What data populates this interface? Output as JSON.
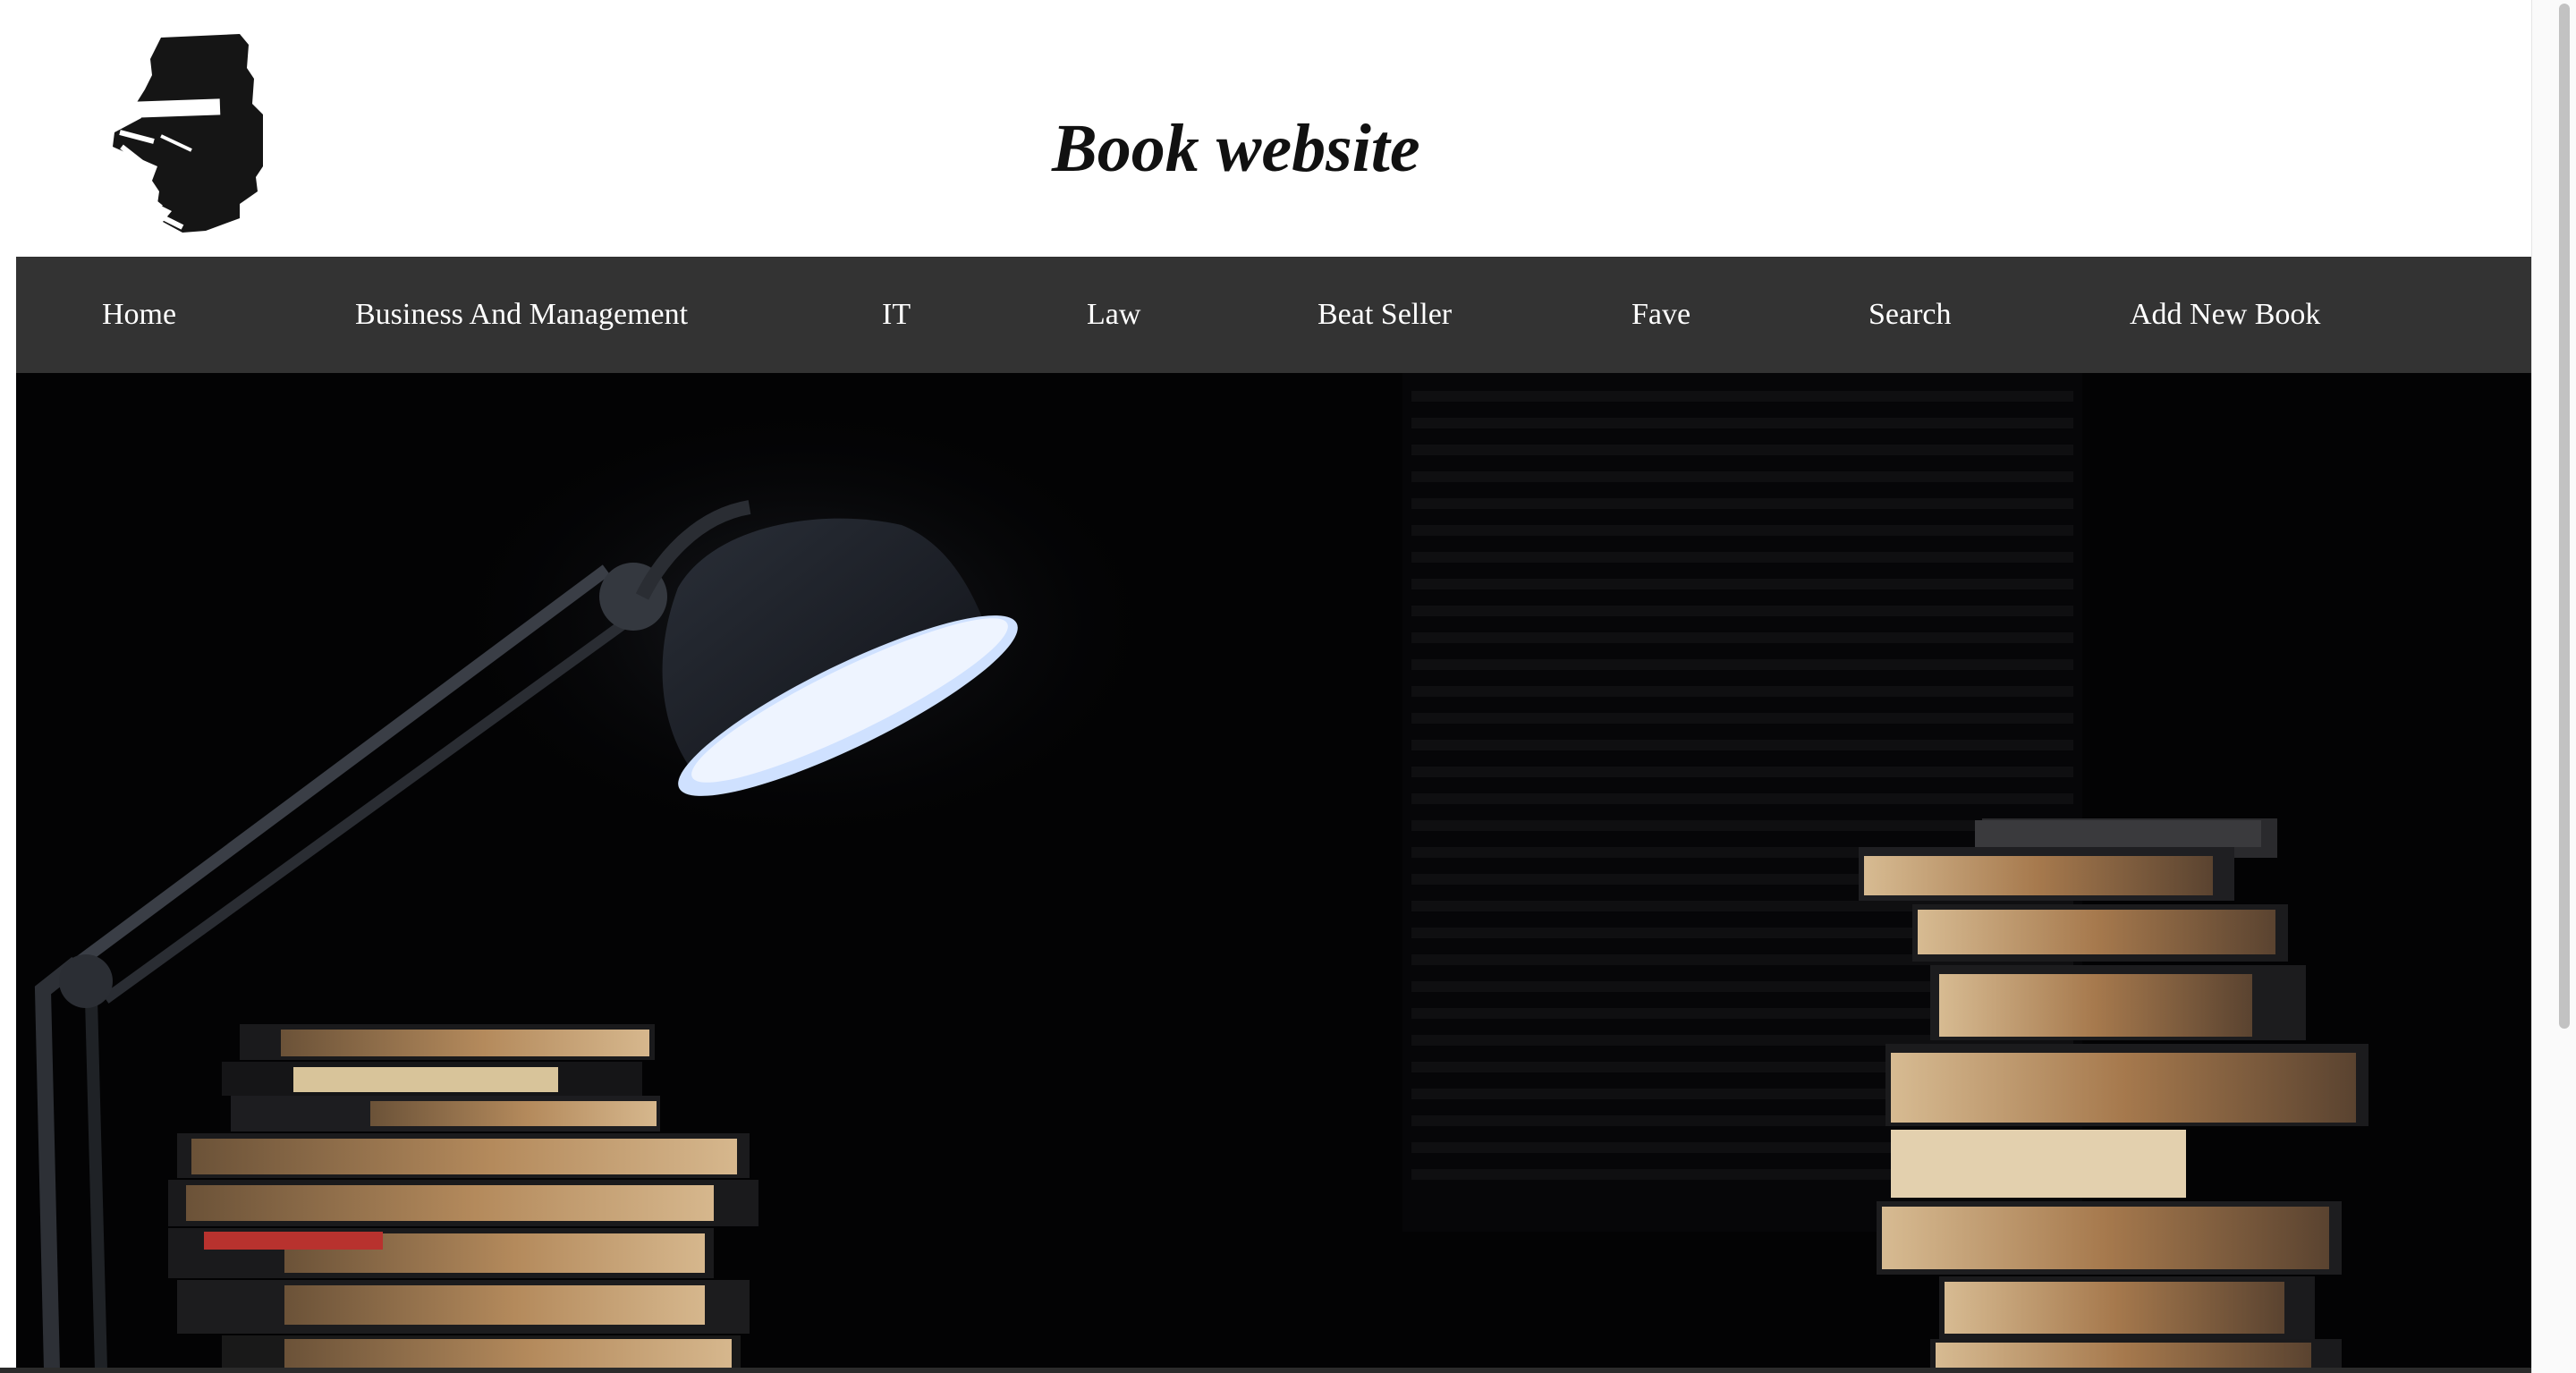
{
  "header": {
    "title": "Book website",
    "logo_icon": "book-stack-icon"
  },
  "nav": {
    "items": [
      {
        "label": "Home"
      },
      {
        "label": "Business And Management"
      },
      {
        "label": "IT"
      },
      {
        "label": "Law"
      },
      {
        "label": "Beat Seller"
      },
      {
        "label": "Fave"
      },
      {
        "label": "Search"
      },
      {
        "label": "Add New Book"
      }
    ]
  },
  "hero": {
    "image_subject": "desk-lamp-and-book-stacks"
  },
  "colors": {
    "navbar_bg": "#333333",
    "nav_text": "#ffffff",
    "title_text": "#111111",
    "hero_bg": "#030304"
  }
}
